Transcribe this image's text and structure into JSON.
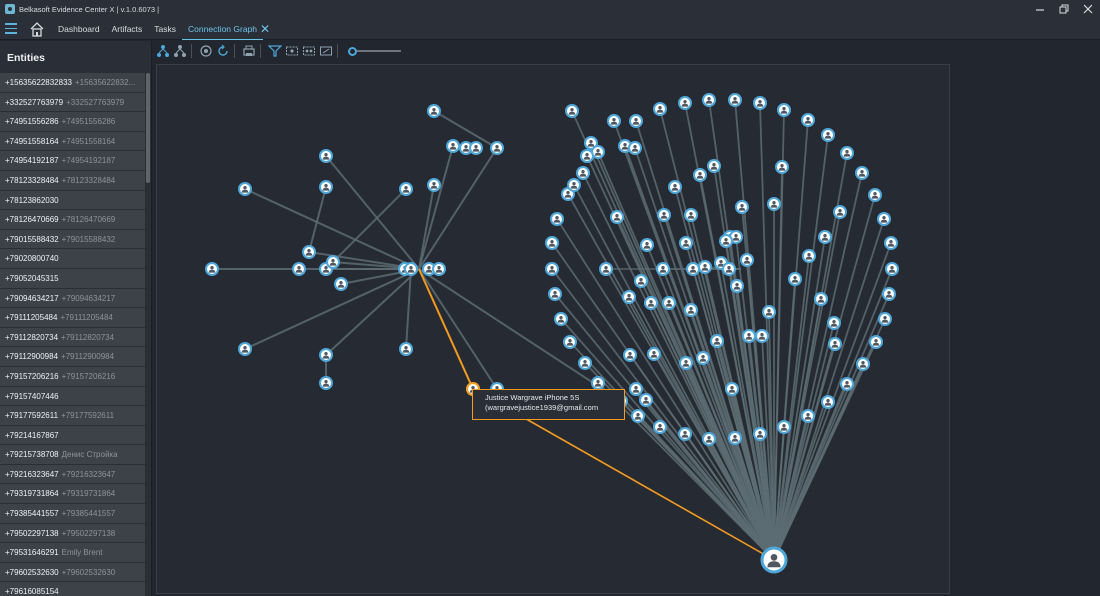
{
  "window": {
    "title": "Belkasoft Evidence Center X | v.1.0.6073 |",
    "minimize_icon": "minimize-icon",
    "maximize_icon": "restore-icon",
    "close_icon": "close-icon"
  },
  "menu": {
    "items": [
      "Dashboard",
      "Artifacts",
      "Tasks"
    ],
    "active_tab": "Connection Graph"
  },
  "sidebar": {
    "title": "Entities",
    "entities": [
      {
        "number": "+15635622832833",
        "alias": "+15635622832..."
      },
      {
        "number": "+332527763979",
        "alias": "+332527763979"
      },
      {
        "number": "+74951556286",
        "alias": "+74951556286"
      },
      {
        "number": "+74951558164",
        "alias": "+74951558164"
      },
      {
        "number": "+74954192187",
        "alias": "+74954192187"
      },
      {
        "number": "+78123328484",
        "alias": "+78123328484"
      },
      {
        "number": "+78123862030",
        "alias": ""
      },
      {
        "number": "+78126470669",
        "alias": "+78126470669"
      },
      {
        "number": "+79015588432",
        "alias": "+79015588432"
      },
      {
        "number": "+79020800740",
        "alias": ""
      },
      {
        "number": "+79052045315",
        "alias": ""
      },
      {
        "number": "+79094634217",
        "alias": "+79094634217"
      },
      {
        "number": "+79111205484",
        "alias": "+79111205484"
      },
      {
        "number": "+79112820734",
        "alias": "+79112820734"
      },
      {
        "number": "+79112900984",
        "alias": "+79112900984"
      },
      {
        "number": "+79157206216",
        "alias": "+79157206216"
      },
      {
        "number": "+79157407446",
        "alias": ""
      },
      {
        "number": "+79177592611",
        "alias": "+79177592611"
      },
      {
        "number": "+79214167867",
        "alias": ""
      },
      {
        "number": "+79215738708",
        "alias": "Денис Стройка"
      },
      {
        "number": "+79216323647",
        "alias": "+79216323647"
      },
      {
        "number": "+79319731864",
        "alias": "+79319731864"
      },
      {
        "number": "+79385441557",
        "alias": "+79385441557"
      },
      {
        "number": "+79502297138",
        "alias": "+79502297138"
      },
      {
        "number": "+79531646291",
        "alias": "Emily Brent"
      },
      {
        "number": "+79602532630",
        "alias": "+79602532630"
      },
      {
        "number": "+79616085154",
        "alias": ""
      }
    ]
  },
  "toolbar": {
    "icons": [
      "layout-hierarchy-icon",
      "layout-tree-icon",
      "layout-radial-icon",
      "refresh-icon",
      "print-icon",
      "filter-icon",
      "select-icon",
      "select-all-icon",
      "export-icon",
      "zoom-icon"
    ]
  },
  "tooltip": {
    "line1": "Justice Wargrave iPhone 5S",
    "line2": "(wargravejustice1939@gmail.com"
  },
  "colors": {
    "accent": "#4ea7d9",
    "highlight": "#f29b21",
    "edge": "#5c6c72"
  }
}
